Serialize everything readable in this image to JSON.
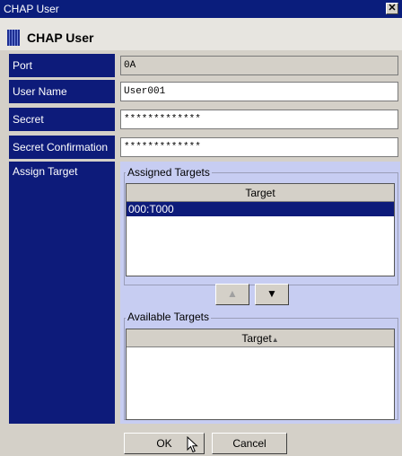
{
  "window": {
    "title": "CHAP User",
    "close_glyph": "✕"
  },
  "header": {
    "title": "CHAP User",
    "icon": "chap-user-icon"
  },
  "form": {
    "port_label": "Port",
    "port_value": "0A",
    "user_name_label": "User Name",
    "user_name_value": "User001",
    "secret_label": "Secret",
    "secret_value": "*************",
    "secret_confirmation_label": "Secret Confirmation",
    "secret_confirmation_value": "*************",
    "assign_target_label": "Assign Target"
  },
  "assigned": {
    "group_title": "Assigned Targets",
    "column_header": "Target",
    "rows": [
      "000:T000"
    ]
  },
  "move_buttons": {
    "up_glyph": "▲",
    "down_glyph": "▼"
  },
  "available": {
    "group_title": "Available Targets",
    "column_header": "Target",
    "sort_glyph": "▲"
  },
  "footer": {
    "ok_label": "OK",
    "cancel_label": "Cancel"
  },
  "colors": {
    "title_bar": "#0a1d7c",
    "label_bg": "#0d1b7a",
    "panel_bg": "#c7cdf2",
    "selection": "#0d1b7a"
  }
}
